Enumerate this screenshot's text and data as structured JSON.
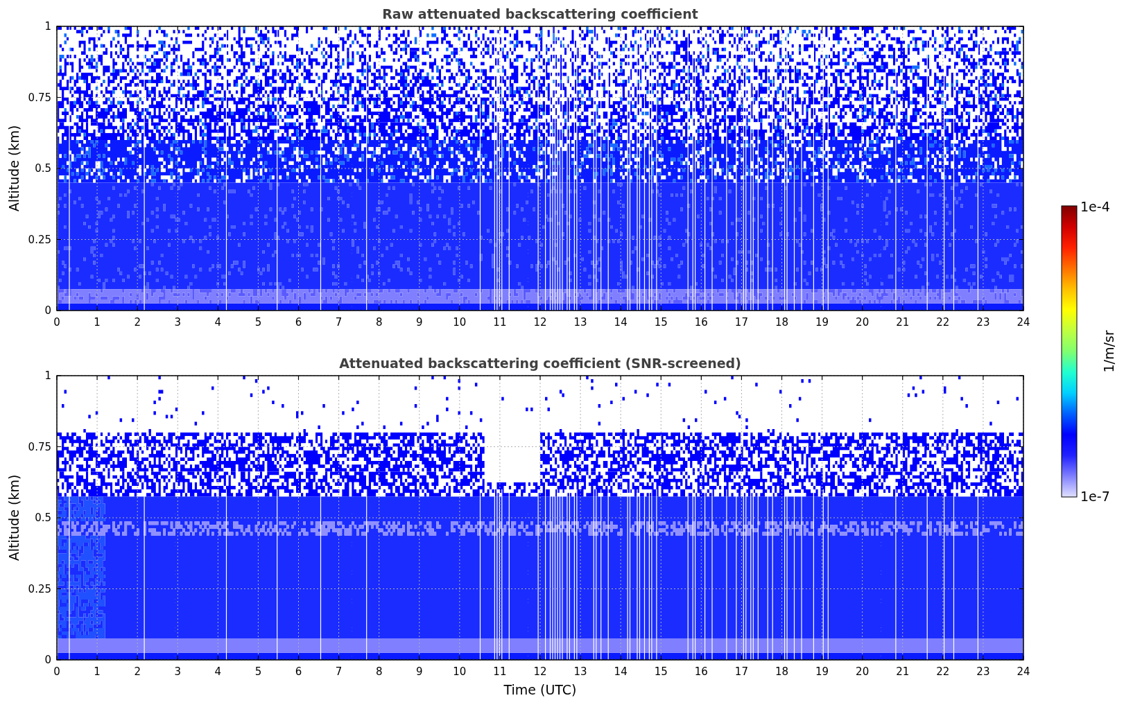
{
  "panels": [
    {
      "kind": "raw",
      "title": "Raw attenuated backscattering coefficient",
      "ylabel": "Altitude (km)",
      "yticks": [
        "1",
        "0.75",
        "0.5",
        "0.25",
        "0"
      ],
      "xticks": [
        "0",
        "1",
        "2",
        "3",
        "4",
        "5",
        "6",
        "7",
        "8",
        "9",
        "10",
        "11",
        "12",
        "13",
        "14",
        "15",
        "16",
        "17",
        "18",
        "19",
        "20",
        "21",
        "22",
        "23",
        "24"
      ]
    },
    {
      "kind": "screened",
      "title": "Attenuated backscattering coefficient (SNR-screened)",
      "ylabel": "Altitude (km)",
      "yticks": [
        "1",
        "0.75",
        "0.5",
        "0.25",
        "0"
      ],
      "xticks": [
        "0",
        "1",
        "2",
        "3",
        "4",
        "5",
        "6",
        "7",
        "8",
        "9",
        "10",
        "11",
        "12",
        "13",
        "14",
        "15",
        "16",
        "17",
        "18",
        "19",
        "20",
        "21",
        "22",
        "23",
        "24"
      ],
      "xlabel": "Time (UTC)"
    }
  ],
  "colorbar": {
    "max_label": "1e-4",
    "min_label": "1e-7",
    "unit": "1/m/sr"
  }
}
